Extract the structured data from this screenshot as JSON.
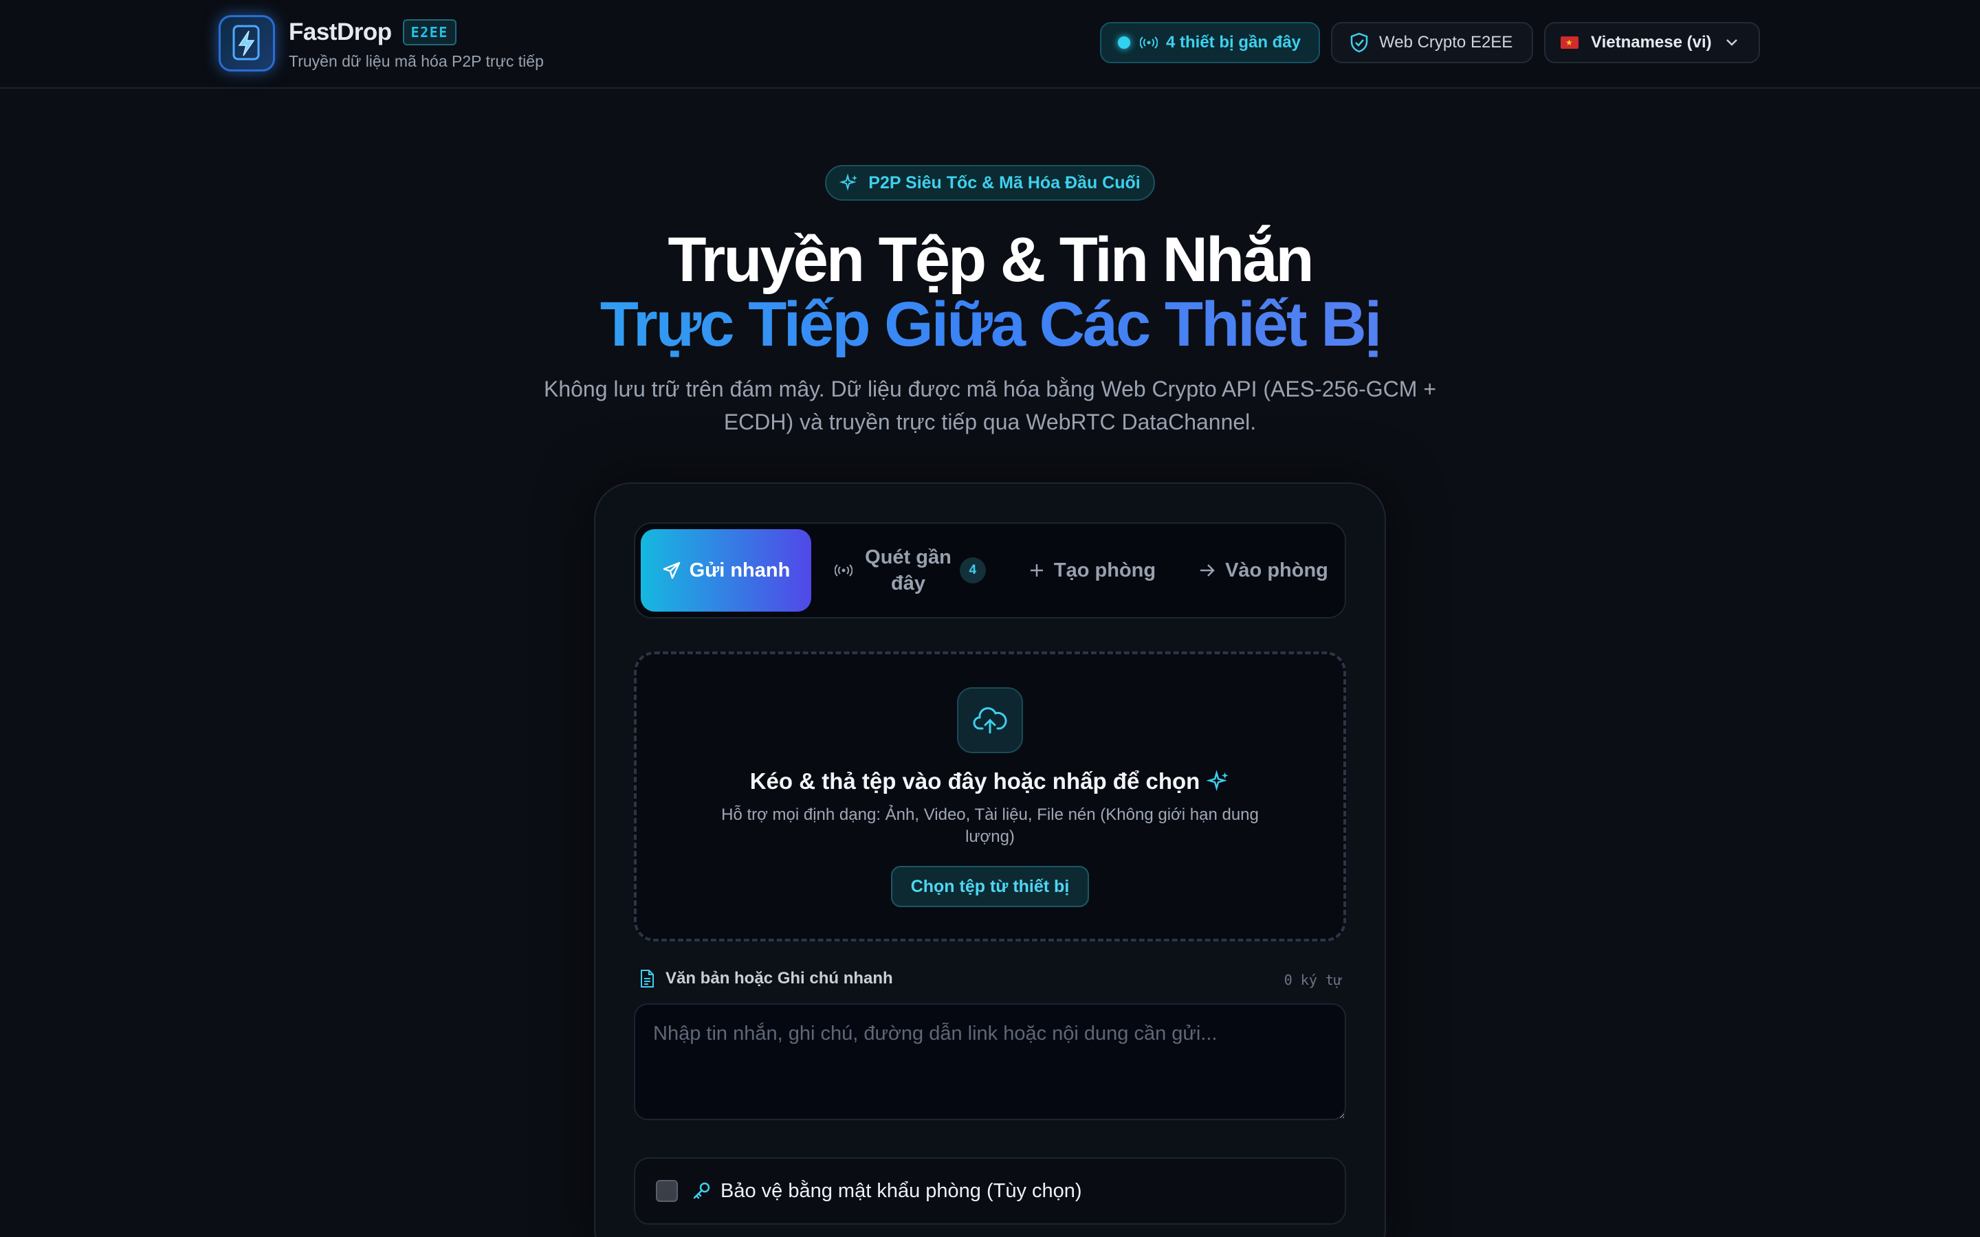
{
  "header": {
    "brand_name": "FastDrop",
    "brand_badge": "E2EE",
    "brand_subtitle": "Truyền dữ liệu mã hóa P2P trực tiếp",
    "nearby_label": "4 thiết bị gần đây",
    "crypto_label": "Web Crypto E2EE",
    "language_label": "Vietnamese (vi)",
    "language_flag_icon": "vietnam-flag-icon"
  },
  "hero": {
    "chip": "P2P Siêu Tốc & Mã Hóa Đầu Cuối",
    "title_line1": "Truyền Tệp & Tin Nhắn",
    "title_line2": "Trực Tiếp Giữa Các Thiết Bị",
    "description_line1": "Không lưu trữ trên đám mây. Dữ liệu được mã hóa bằng Web Crypto API (AES-256-GCM +",
    "description_line2": "ECDH) và truyền trực tiếp qua WebRTC DataChannel."
  },
  "tabs": [
    {
      "label": "Gửi nhanh",
      "icon": "send-icon",
      "active": true
    },
    {
      "label_line1": "Quét gần",
      "label_line2": "đây",
      "icon": "broadcast-icon",
      "badge": "4"
    },
    {
      "label": "Tạo phòng",
      "icon": "plus-icon"
    },
    {
      "label": "Vào phòng",
      "icon": "arrow-right-icon"
    }
  ],
  "dropzone": {
    "title": "Kéo & thả tệp vào đây hoặc nhấp để chọn",
    "subtitle_line1": "Hỗ trợ mọi định dạng: Ảnh, Video, Tài liệu, File nén (Không giới hạn dung",
    "subtitle_line2": "lượng)",
    "button": "Chọn tệp từ thiết bị"
  },
  "note": {
    "label": "Văn bản hoặc Ghi chú nhanh",
    "char_count": "0 ký tự",
    "value": "",
    "placeholder": "Nhập tin nhắn, ghi chú, đường dẫn link hoặc nội dung cần gửi..."
  },
  "password": {
    "label": "Bảo vệ bằng mật khẩu phòng (Tùy chọn)",
    "checked": false
  },
  "colors": {
    "background": "#0b0e14",
    "accent_cyan": "#22c6ea",
    "accent_blue": "#3b82f6",
    "accent_violet": "#7c7fe8"
  }
}
